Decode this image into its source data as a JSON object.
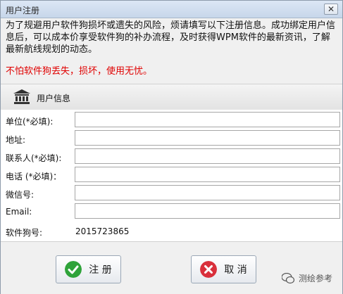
{
  "window": {
    "title": "用户注册",
    "close_glyph": "✕"
  },
  "intro_text": "为了规避用户软件狗损坏或遗失的风险，烦请填写以下注册信息。成功绑定用户信息后，可以成本价享受软件狗的补办流程，及时获得WPM软件的最新资讯，了解最新航线规划的动态。",
  "warning_text": "不怕软件狗丢失，损坏，使用无忧。",
  "section": {
    "title": "用户信息",
    "icon": "bank-icon"
  },
  "form": {
    "fields": [
      {
        "label": "单位(*必填):",
        "value": ""
      },
      {
        "label": "地址:",
        "value": ""
      },
      {
        "label": "联系人(*必填):",
        "value": ""
      },
      {
        "label": "电话 (*必填)：",
        "value": ""
      },
      {
        "label": "微信号:",
        "value": ""
      },
      {
        "label": "Email:",
        "value": ""
      }
    ],
    "dongle_label": "软件狗号:",
    "dongle_value": "2015723865"
  },
  "buttons": {
    "register_label": "注 册",
    "cancel_label": "取 消"
  },
  "watermark_text": "测绘参考",
  "colors": {
    "warning": "#e00000",
    "register_icon": "#2fa33a",
    "cancel_icon": "#d9303c"
  }
}
